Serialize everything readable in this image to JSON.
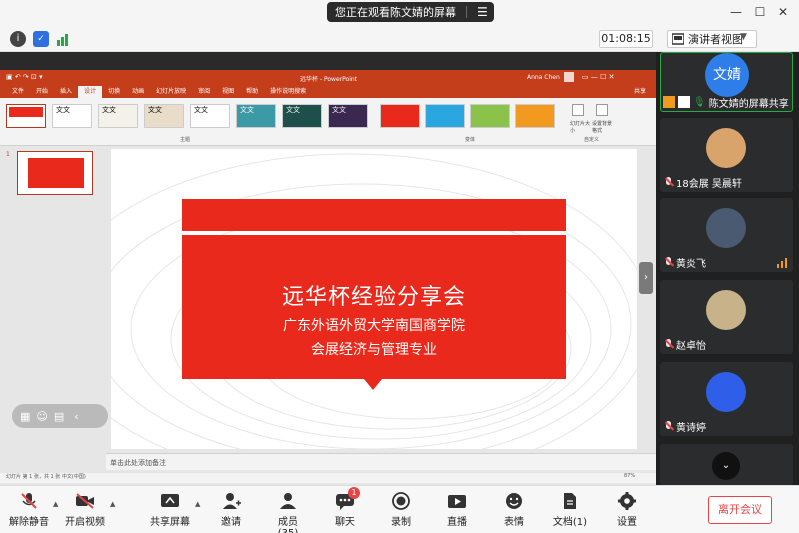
{
  "titlebar": {
    "share_notice": "您正在观看陈文婧的屏幕",
    "menu_icon": "hamburger-icon",
    "win_min": "—",
    "win_max": "☐",
    "win_close": "✕"
  },
  "infobar": {
    "timer": "01:08:15",
    "view_mode": "演讲者视图"
  },
  "powerpoint": {
    "window_title": "远华杯 - PowerPoint",
    "user_name": "Anna Chen",
    "share_btn": "共享",
    "tabs": [
      "文件",
      "开始",
      "插入",
      "设计",
      "切换",
      "动画",
      "幻灯片放映",
      "审阅",
      "视图",
      "帮助",
      "操作说明搜索"
    ],
    "active_tab": "设计",
    "theme_label": "主题",
    "variant_label": "变体",
    "custom_label": "自定义",
    "slide_size": "幻灯片大小",
    "bg_format": "设置背景格式",
    "theme_sample": "文文",
    "slide_number": "1",
    "slide": {
      "title": "远华杯经验分享会",
      "line1": "广东外语外贸大学南国商学院",
      "line2": "会展经济与管理专业"
    },
    "notes_placeholder": "单击此处添加备注",
    "status_left": "幻灯片 第 1 张，共 1 张    中文(中国)",
    "zoom": "87%"
  },
  "colors": {
    "slide_red": "#e8291c",
    "ppt_accent": "#c43e1c",
    "leave_red": "#e54545"
  },
  "participants": [
    {
      "name": "陈文婧的屏幕共享",
      "avatar_text": "文婧",
      "avatar_color": "#2f7de8"
    },
    {
      "name": "18会展 吴晨轩",
      "avatar_color": "#d9a46b"
    },
    {
      "name": "黄炎飞",
      "avatar_color": "#4a5a70"
    },
    {
      "name": "赵卓怡",
      "avatar_color": "#c8b28a"
    },
    {
      "name": "黄诗婷",
      "avatar_color": "#2f5fe8"
    }
  ],
  "toolbar": {
    "unmute": "解除静音",
    "video": "开启视频",
    "share": "共享屏幕",
    "invite": "邀请",
    "members": "成员(35)",
    "chat": "聊天",
    "chat_badge": "1",
    "record": "录制",
    "live": "直播",
    "reactions": "表情",
    "docs": "文档(1)",
    "settings": "设置",
    "leave": "离开会议"
  }
}
